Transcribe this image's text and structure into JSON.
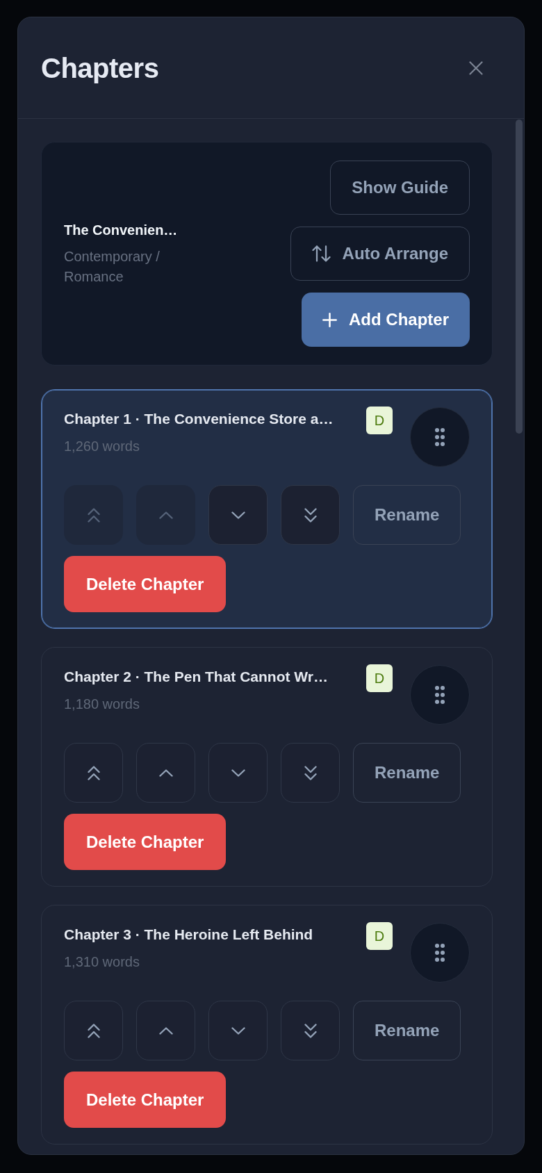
{
  "header": {
    "title": "Chapters"
  },
  "project": {
    "title": "The Convenien…",
    "genre": "Contemporary / Romance",
    "buttons": [
      {
        "kind": "guide",
        "label": "Show Guide"
      },
      {
        "kind": "arrange",
        "label": "Auto Arrange"
      },
      {
        "kind": "add",
        "label": "Add Chapter"
      }
    ]
  },
  "chapters": [
    {
      "title": "Chapter 1 · The Convenience Store a…",
      "words": "1,260 words",
      "badge": "D",
      "selected": true,
      "moves": [
        {
          "kind": "top",
          "disabled": true
        },
        {
          "kind": "up",
          "disabled": true
        },
        {
          "kind": "down",
          "disabled": false
        },
        {
          "kind": "bottom",
          "disabled": false
        }
      ],
      "rename": "Rename",
      "delete": "Delete Chapter"
    },
    {
      "title": "Chapter 2 · The Pen That Cannot Wr…",
      "words": "1,180 words",
      "badge": "D",
      "selected": false,
      "moves": [
        {
          "kind": "top",
          "disabled": false
        },
        {
          "kind": "up",
          "disabled": false
        },
        {
          "kind": "down",
          "disabled": false
        },
        {
          "kind": "bottom",
          "disabled": false
        }
      ],
      "rename": "Rename",
      "delete": "Delete Chapter"
    },
    {
      "title": "Chapter 3 · The Heroine Left Behind",
      "words": "1,310 words",
      "badge": "D",
      "selected": false,
      "moves": [
        {
          "kind": "top",
          "disabled": false
        },
        {
          "kind": "up",
          "disabled": false
        },
        {
          "kind": "down",
          "disabled": false
        },
        {
          "kind": "bottom",
          "disabled": false
        }
      ],
      "rename": "Rename",
      "delete": "Delete Chapter"
    }
  ]
}
